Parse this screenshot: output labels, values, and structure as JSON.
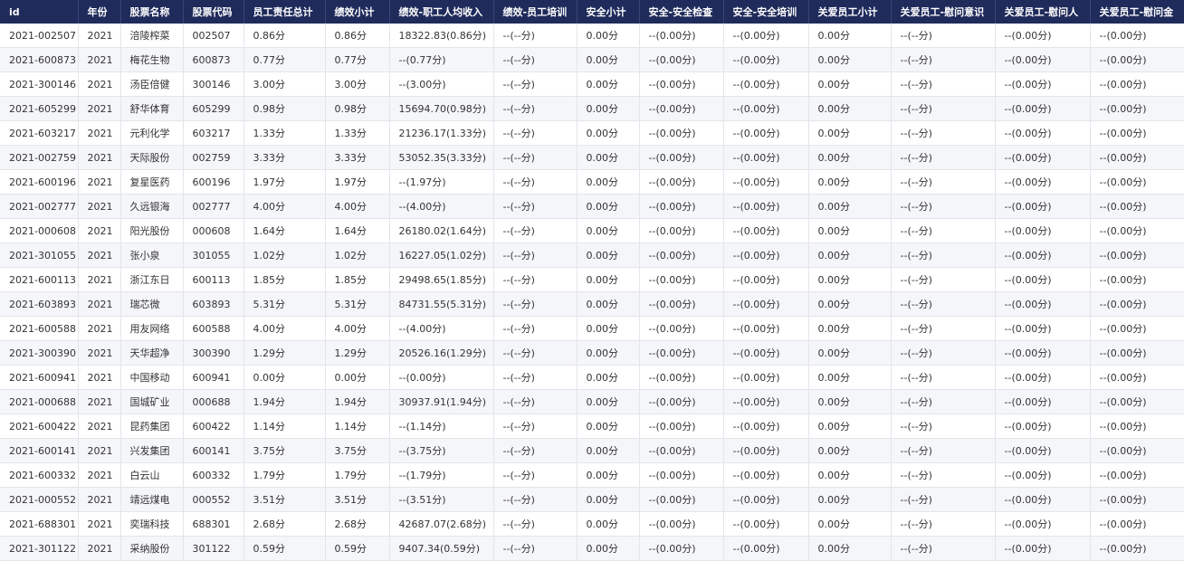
{
  "columns": [
    "id",
    "年份",
    "股票名称",
    "股票代码",
    "员工责任总计",
    "绩效小计",
    "绩效-职工人均收入",
    "绩效-员工培训",
    "安全小计",
    "安全-安全检查",
    "安全-安全培训",
    "关爱员工小计",
    "关爱员工-慰问意识",
    "关爱员工-慰问人",
    "关爱员工-慰问金"
  ],
  "rows": [
    [
      "2021-002507",
      "2021",
      "涪陵榨菜",
      "002507",
      "0.86分",
      "0.86分",
      "18322.83(0.86分)",
      "--(--分)",
      "0.00分",
      "--(0.00分)",
      "--(0.00分)",
      "0.00分",
      "--(--分)",
      "--(0.00分)",
      "--(0.00分)"
    ],
    [
      "2021-600873",
      "2021",
      "梅花生物",
      "600873",
      "0.77分",
      "0.77分",
      "--(0.77分)",
      "--(--分)",
      "0.00分",
      "--(0.00分)",
      "--(0.00分)",
      "0.00分",
      "--(--分)",
      "--(0.00分)",
      "--(0.00分)"
    ],
    [
      "2021-300146",
      "2021",
      "汤臣倍健",
      "300146",
      "3.00分",
      "3.00分",
      "--(3.00分)",
      "--(--分)",
      "0.00分",
      "--(0.00分)",
      "--(0.00分)",
      "0.00分",
      "--(--分)",
      "--(0.00分)",
      "--(0.00分)"
    ],
    [
      "2021-605299",
      "2021",
      "舒华体育",
      "605299",
      "0.98分",
      "0.98分",
      "15694.70(0.98分)",
      "--(--分)",
      "0.00分",
      "--(0.00分)",
      "--(0.00分)",
      "0.00分",
      "--(--分)",
      "--(0.00分)",
      "--(0.00分)"
    ],
    [
      "2021-603217",
      "2021",
      "元利化学",
      "603217",
      "1.33分",
      "1.33分",
      "21236.17(1.33分)",
      "--(--分)",
      "0.00分",
      "--(0.00分)",
      "--(0.00分)",
      "0.00分",
      "--(--分)",
      "--(0.00分)",
      "--(0.00分)"
    ],
    [
      "2021-002759",
      "2021",
      "天际股份",
      "002759",
      "3.33分",
      "3.33分",
      "53052.35(3.33分)",
      "--(--分)",
      "0.00分",
      "--(0.00分)",
      "--(0.00分)",
      "0.00分",
      "--(--分)",
      "--(0.00分)",
      "--(0.00分)"
    ],
    [
      "2021-600196",
      "2021",
      "复星医药",
      "600196",
      "1.97分",
      "1.97分",
      "--(1.97分)",
      "--(--分)",
      "0.00分",
      "--(0.00分)",
      "--(0.00分)",
      "0.00分",
      "--(--分)",
      "--(0.00分)",
      "--(0.00分)"
    ],
    [
      "2021-002777",
      "2021",
      "久远银海",
      "002777",
      "4.00分",
      "4.00分",
      "--(4.00分)",
      "--(--分)",
      "0.00分",
      "--(0.00分)",
      "--(0.00分)",
      "0.00分",
      "--(--分)",
      "--(0.00分)",
      "--(0.00分)"
    ],
    [
      "2021-000608",
      "2021",
      "阳光股份",
      "000608",
      "1.64分",
      "1.64分",
      "26180.02(1.64分)",
      "--(--分)",
      "0.00分",
      "--(0.00分)",
      "--(0.00分)",
      "0.00分",
      "--(--分)",
      "--(0.00分)",
      "--(0.00分)"
    ],
    [
      "2021-301055",
      "2021",
      "张小泉",
      "301055",
      "1.02分",
      "1.02分",
      "16227.05(1.02分)",
      "--(--分)",
      "0.00分",
      "--(0.00分)",
      "--(0.00分)",
      "0.00分",
      "--(--分)",
      "--(0.00分)",
      "--(0.00分)"
    ],
    [
      "2021-600113",
      "2021",
      "浙江东日",
      "600113",
      "1.85分",
      "1.85分",
      "29498.65(1.85分)",
      "--(--分)",
      "0.00分",
      "--(0.00分)",
      "--(0.00分)",
      "0.00分",
      "--(--分)",
      "--(0.00分)",
      "--(0.00分)"
    ],
    [
      "2021-603893",
      "2021",
      "瑞芯微",
      "603893",
      "5.31分",
      "5.31分",
      "84731.55(5.31分)",
      "--(--分)",
      "0.00分",
      "--(0.00分)",
      "--(0.00分)",
      "0.00分",
      "--(--分)",
      "--(0.00分)",
      "--(0.00分)"
    ],
    [
      "2021-600588",
      "2021",
      "用友网络",
      "600588",
      "4.00分",
      "4.00分",
      "--(4.00分)",
      "--(--分)",
      "0.00分",
      "--(0.00分)",
      "--(0.00分)",
      "0.00分",
      "--(--分)",
      "--(0.00分)",
      "--(0.00分)"
    ],
    [
      "2021-300390",
      "2021",
      "天华超净",
      "300390",
      "1.29分",
      "1.29分",
      "20526.16(1.29分)",
      "--(--分)",
      "0.00分",
      "--(0.00分)",
      "--(0.00分)",
      "0.00分",
      "--(--分)",
      "--(0.00分)",
      "--(0.00分)"
    ],
    [
      "2021-600941",
      "2021",
      "中国移动",
      "600941",
      "0.00分",
      "0.00分",
      "--(0.00分)",
      "--(--分)",
      "0.00分",
      "--(0.00分)",
      "--(0.00分)",
      "0.00分",
      "--(--分)",
      "--(0.00分)",
      "--(0.00分)"
    ],
    [
      "2021-000688",
      "2021",
      "国城矿业",
      "000688",
      "1.94分",
      "1.94分",
      "30937.91(1.94分)",
      "--(--分)",
      "0.00分",
      "--(0.00分)",
      "--(0.00分)",
      "0.00分",
      "--(--分)",
      "--(0.00分)",
      "--(0.00分)"
    ],
    [
      "2021-600422",
      "2021",
      "昆药集团",
      "600422",
      "1.14分",
      "1.14分",
      "--(1.14分)",
      "--(--分)",
      "0.00分",
      "--(0.00分)",
      "--(0.00分)",
      "0.00分",
      "--(--分)",
      "--(0.00分)",
      "--(0.00分)"
    ],
    [
      "2021-600141",
      "2021",
      "兴发集团",
      "600141",
      "3.75分",
      "3.75分",
      "--(3.75分)",
      "--(--分)",
      "0.00分",
      "--(0.00分)",
      "--(0.00分)",
      "0.00分",
      "--(--分)",
      "--(0.00分)",
      "--(0.00分)"
    ],
    [
      "2021-600332",
      "2021",
      "白云山",
      "600332",
      "1.79分",
      "1.79分",
      "--(1.79分)",
      "--(--分)",
      "0.00分",
      "--(0.00分)",
      "--(0.00分)",
      "0.00分",
      "--(--分)",
      "--(0.00分)",
      "--(0.00分)"
    ],
    [
      "2021-000552",
      "2021",
      "靖远煤电",
      "000552",
      "3.51分",
      "3.51分",
      "--(3.51分)",
      "--(--分)",
      "0.00分",
      "--(0.00分)",
      "--(0.00分)",
      "0.00分",
      "--(--分)",
      "--(0.00分)",
      "--(0.00分)"
    ],
    [
      "2021-688301",
      "2021",
      "奕瑞科技",
      "688301",
      "2.68分",
      "2.68分",
      "42687.07(2.68分)",
      "--(--分)",
      "0.00分",
      "--(0.00分)",
      "--(0.00分)",
      "0.00分",
      "--(--分)",
      "--(0.00分)",
      "--(0.00分)"
    ],
    [
      "2021-301122",
      "2021",
      "采纳股份",
      "301122",
      "0.59分",
      "0.59分",
      "9407.34(0.59分)",
      "--(--分)",
      "0.00分",
      "--(0.00分)",
      "--(0.00分)",
      "0.00分",
      "--(--分)",
      "--(0.00分)",
      "--(0.00分)"
    ]
  ]
}
